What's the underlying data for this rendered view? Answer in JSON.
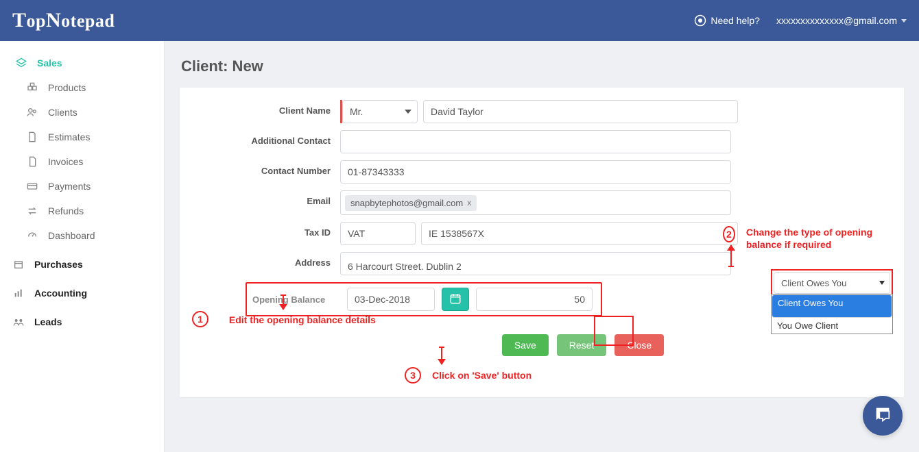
{
  "header": {
    "logo_html": "TopNotepad",
    "need_help": "Need help?",
    "email": "xxxxxxxxxxxxxx@gmail.com"
  },
  "sidebar": {
    "sales": "Sales",
    "products": "Products",
    "clients": "Clients",
    "estimates": "Estimates",
    "invoices": "Invoices",
    "payments": "Payments",
    "refunds": "Refunds",
    "dashboard": "Dashboard",
    "purchases": "Purchases",
    "accounting": "Accounting",
    "leads": "Leads"
  },
  "page": {
    "title": "Client: New"
  },
  "form": {
    "client_name_label": "Client Name",
    "title_value": "Mr.",
    "name_value": "David Taylor",
    "additional_contact_label": "Additional Contact",
    "additional_contact_value": "",
    "contact_number_label": "Contact Number",
    "contact_number_value": "01-87343333",
    "email_label": "Email",
    "email_chip": "snapbytephotos@gmail.com",
    "email_chip_x": "x",
    "tax_id_label": "Tax ID",
    "tax_type_value": "VAT",
    "tax_val_value": "IE 1538567X",
    "address_label": "Address",
    "address_value": "6 Harcourt Street. Dublin 2",
    "opening_balance_label": "Opening Balance",
    "ob_date": "03-Dec-2018",
    "ob_amount": "50",
    "ob_type": "Client Owes You",
    "ob_option1": "Client Owes You",
    "ob_option2": "You Owe Client"
  },
  "buttons": {
    "save": "Save",
    "reset": "Reset",
    "close": "Close"
  },
  "annotations": {
    "n1": "1",
    "t1": "Edit the opening balance details",
    "n2": "2",
    "t2": "Change the type of opening balance if required",
    "n3": "3",
    "t3": "Click on 'Save' button"
  }
}
